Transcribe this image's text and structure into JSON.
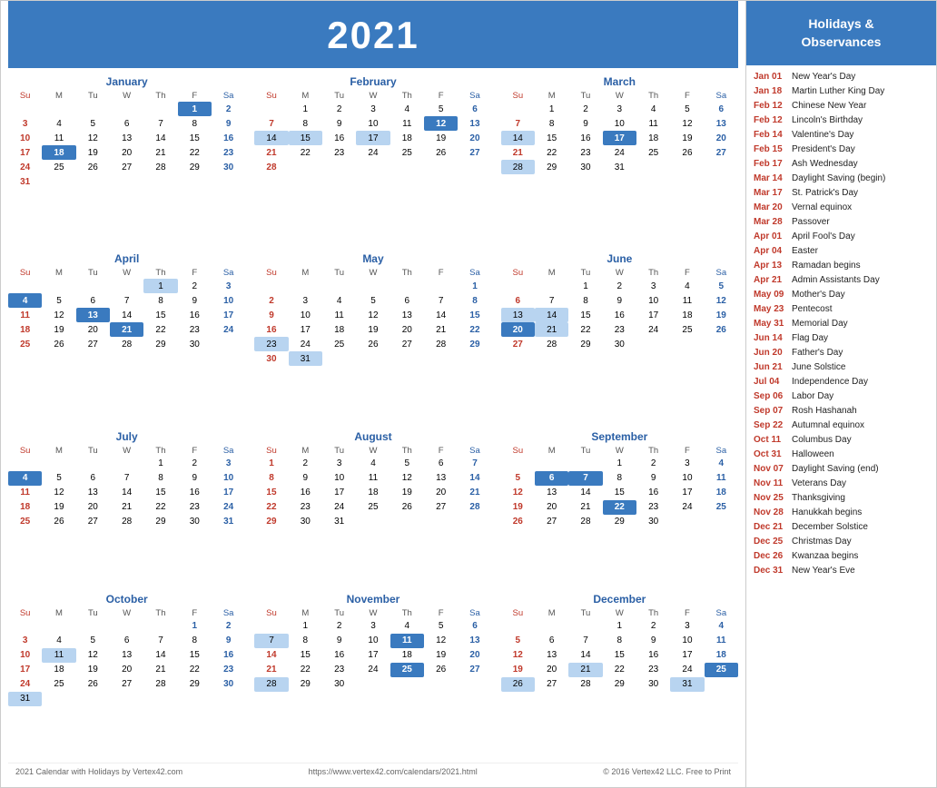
{
  "year": "2021",
  "holidays_header": "Holidays &\nObservances",
  "months": [
    {
      "name": "January",
      "days": [
        [
          null,
          null,
          null,
          null,
          null,
          1,
          2
        ],
        [
          3,
          4,
          5,
          6,
          7,
          8,
          9
        ],
        [
          10,
          11,
          12,
          13,
          14,
          15,
          16
        ],
        [
          17,
          18,
          19,
          20,
          21,
          22,
          23
        ],
        [
          24,
          25,
          26,
          27,
          28,
          29,
          30
        ],
        [
          31,
          null,
          null,
          null,
          null,
          null,
          null
        ]
      ],
      "highlights": {
        "1": "blue",
        "2": "sat",
        "18": "blue"
      }
    },
    {
      "name": "February",
      "days": [
        [
          null,
          1,
          2,
          3,
          4,
          5,
          6
        ],
        [
          7,
          8,
          9,
          10,
          11,
          12,
          13
        ],
        [
          14,
          15,
          16,
          17,
          18,
          19,
          20
        ],
        [
          21,
          22,
          23,
          24,
          25,
          26,
          27
        ],
        [
          28,
          null,
          null,
          null,
          null,
          null,
          null
        ]
      ],
      "highlights": {
        "6": "sat",
        "12": "blue",
        "13": "sat",
        "14": "light",
        "15": "light",
        "17": "light",
        "20": "sat"
      }
    },
    {
      "name": "March",
      "days": [
        [
          null,
          1,
          2,
          3,
          4,
          5,
          6
        ],
        [
          7,
          8,
          9,
          10,
          11,
          12,
          13
        ],
        [
          14,
          15,
          16,
          17,
          18,
          19,
          20
        ],
        [
          21,
          22,
          23,
          24,
          25,
          26,
          27
        ],
        [
          28,
          29,
          30,
          31,
          null,
          null,
          null
        ]
      ],
      "highlights": {
        "6": "sat",
        "13": "sat",
        "14": "light",
        "17": "blue",
        "20": "sat",
        "28": "light"
      }
    },
    {
      "name": "April",
      "days": [
        [
          null,
          null,
          null,
          null,
          1,
          2,
          3
        ],
        [
          4,
          5,
          6,
          7,
          8,
          9,
          10
        ],
        [
          11,
          12,
          13,
          14,
          15,
          16,
          17
        ],
        [
          18,
          19,
          20,
          21,
          22,
          23,
          24
        ],
        [
          25,
          26,
          27,
          28,
          29,
          30,
          null
        ]
      ],
      "highlights": {
        "1": "light",
        "3": "sat",
        "4": "blue",
        "10": "sat",
        "13": "blue",
        "17": "sat",
        "21": "blue",
        "24": "sat"
      }
    },
    {
      "name": "May",
      "days": [
        [
          null,
          null,
          null,
          null,
          null,
          null,
          1
        ],
        [
          2,
          3,
          4,
          5,
          6,
          7,
          8
        ],
        [
          9,
          10,
          11,
          12,
          13,
          14,
          15
        ],
        [
          16,
          17,
          18,
          19,
          20,
          21,
          22
        ],
        [
          23,
          24,
          25,
          26,
          27,
          28,
          29
        ],
        [
          30,
          31,
          null,
          null,
          null,
          null,
          null
        ]
      ],
      "highlights": {
        "1": "sat",
        "8": "sat",
        "15": "sat",
        "22": "sat",
        "23": "light",
        "29": "sat",
        "31": "light"
      }
    },
    {
      "name": "June",
      "days": [
        [
          null,
          null,
          1,
          2,
          3,
          4,
          5
        ],
        [
          6,
          7,
          8,
          9,
          10,
          11,
          12
        ],
        [
          13,
          14,
          15,
          16,
          17,
          18,
          19
        ],
        [
          20,
          21,
          22,
          23,
          24,
          25,
          26
        ],
        [
          27,
          28,
          29,
          30,
          null,
          null,
          null
        ]
      ],
      "highlights": {
        "5": "sat",
        "12": "sat",
        "13": "light",
        "14": "light",
        "19": "sat",
        "20": "blue",
        "21": "light",
        "26": "sat"
      }
    },
    {
      "name": "July",
      "days": [
        [
          null,
          null,
          null,
          null,
          1,
          2,
          3
        ],
        [
          4,
          5,
          6,
          7,
          8,
          9,
          10
        ],
        [
          11,
          12,
          13,
          14,
          15,
          16,
          17
        ],
        [
          18,
          19,
          20,
          21,
          22,
          23,
          24
        ],
        [
          25,
          26,
          27,
          28,
          29,
          30,
          31
        ]
      ],
      "highlights": {
        "3": "sat",
        "4": "blue",
        "10": "sat",
        "17": "sat",
        "24": "sat",
        "31": "sat"
      }
    },
    {
      "name": "August",
      "days": [
        [
          1,
          2,
          3,
          4,
          5,
          6,
          7
        ],
        [
          8,
          9,
          10,
          11,
          12,
          13,
          14
        ],
        [
          15,
          16,
          17,
          18,
          19,
          20,
          21
        ],
        [
          22,
          23,
          24,
          25,
          26,
          27,
          28
        ],
        [
          29,
          30,
          31,
          null,
          null,
          null,
          null
        ]
      ],
      "highlights": {
        "7": "sat",
        "14": "sat",
        "21": "sat",
        "28": "sat"
      }
    },
    {
      "name": "September",
      "days": [
        [
          null,
          null,
          null,
          1,
          2,
          3,
          4
        ],
        [
          5,
          6,
          7,
          8,
          9,
          10,
          11
        ],
        [
          12,
          13,
          14,
          15,
          16,
          17,
          18
        ],
        [
          19,
          20,
          21,
          22,
          23,
          24,
          25
        ],
        [
          26,
          27,
          28,
          29,
          30,
          null,
          null
        ]
      ],
      "highlights": {
        "4": "sat",
        "6": "blue",
        "7": "blue",
        "11": "sat",
        "18": "sat",
        "22": "blue",
        "25": "sat"
      }
    },
    {
      "name": "October",
      "days": [
        [
          null,
          null,
          null,
          null,
          null,
          1,
          2
        ],
        [
          3,
          4,
          5,
          6,
          7,
          8,
          9
        ],
        [
          10,
          11,
          12,
          13,
          14,
          15,
          16
        ],
        [
          17,
          18,
          19,
          20,
          21,
          22,
          23
        ],
        [
          24,
          25,
          26,
          27,
          28,
          29,
          30
        ],
        [
          31,
          null,
          null,
          null,
          null,
          null,
          null
        ]
      ],
      "highlights": {
        "1": "sat",
        "2": "sat",
        "9": "sat",
        "11": "light",
        "16": "sat",
        "23": "sat",
        "30": "sat",
        "31": "light"
      }
    },
    {
      "name": "November",
      "days": [
        [
          null,
          1,
          2,
          3,
          4,
          5,
          6
        ],
        [
          7,
          8,
          9,
          10,
          11,
          12,
          13
        ],
        [
          14,
          15,
          16,
          17,
          18,
          19,
          20
        ],
        [
          21,
          22,
          23,
          24,
          25,
          26,
          27
        ],
        [
          28,
          29,
          30,
          null,
          null,
          null,
          null
        ]
      ],
      "highlights": {
        "6": "sat",
        "7": "light",
        "11": "blue",
        "13": "sat",
        "20": "sat",
        "25": "blue",
        "27": "sat",
        "28": "light"
      }
    },
    {
      "name": "December",
      "days": [
        [
          null,
          null,
          null,
          1,
          2,
          3,
          4
        ],
        [
          5,
          6,
          7,
          8,
          9,
          10,
          11
        ],
        [
          12,
          13,
          14,
          15,
          16,
          17,
          18
        ],
        [
          19,
          20,
          21,
          22,
          23,
          24,
          25
        ],
        [
          26,
          27,
          28,
          29,
          30,
          31,
          null
        ]
      ],
      "highlights": {
        "4": "sat",
        "11": "sat",
        "18": "sat",
        "21": "light",
        "25": "blue",
        "26": "light",
        "31": "light"
      }
    }
  ],
  "holidays": [
    {
      "date": "Jan 01",
      "name": "New Year's Day"
    },
    {
      "date": "Jan 18",
      "name": "Martin Luther King Day"
    },
    {
      "date": "Feb 12",
      "name": "Chinese New Year"
    },
    {
      "date": "Feb 12",
      "name": "Lincoln's Birthday"
    },
    {
      "date": "Feb 14",
      "name": "Valentine's Day"
    },
    {
      "date": "Feb 15",
      "name": "President's Day"
    },
    {
      "date": "Feb 17",
      "name": "Ash Wednesday"
    },
    {
      "date": "Mar 14",
      "name": "Daylight Saving (begin)"
    },
    {
      "date": "Mar 17",
      "name": "St. Patrick's Day"
    },
    {
      "date": "Mar 20",
      "name": "Vernal equinox"
    },
    {
      "date": "Mar 28",
      "name": "Passover"
    },
    {
      "date": "Apr 01",
      "name": "April Fool's Day"
    },
    {
      "date": "Apr 04",
      "name": "Easter"
    },
    {
      "date": "Apr 13",
      "name": "Ramadan begins"
    },
    {
      "date": "Apr 21",
      "name": "Admin Assistants Day"
    },
    {
      "date": "May 09",
      "name": "Mother's Day"
    },
    {
      "date": "May 23",
      "name": "Pentecost"
    },
    {
      "date": "May 31",
      "name": "Memorial Day"
    },
    {
      "date": "Jun 14",
      "name": "Flag Day"
    },
    {
      "date": "Jun 20",
      "name": "Father's Day"
    },
    {
      "date": "Jun 21",
      "name": "June Solstice"
    },
    {
      "date": "Jul 04",
      "name": "Independence Day"
    },
    {
      "date": "Sep 06",
      "name": "Labor Day"
    },
    {
      "date": "Sep 07",
      "name": "Rosh Hashanah"
    },
    {
      "date": "Sep 22",
      "name": "Autumnal equinox"
    },
    {
      "date": "Oct 11",
      "name": "Columbus Day"
    },
    {
      "date": "Oct 31",
      "name": "Halloween"
    },
    {
      "date": "Nov 07",
      "name": "Daylight Saving (end)"
    },
    {
      "date": "Nov 11",
      "name": "Veterans Day"
    },
    {
      "date": "Nov 25",
      "name": "Thanksgiving"
    },
    {
      "date": "Nov 28",
      "name": "Hanukkah begins"
    },
    {
      "date": "Dec 21",
      "name": "December Solstice"
    },
    {
      "date": "Dec 25",
      "name": "Christmas Day"
    },
    {
      "date": "Dec 26",
      "name": "Kwanzaa begins"
    },
    {
      "date": "Dec 31",
      "name": "New Year's Eve"
    }
  ],
  "footer": {
    "left": "2021 Calendar with Holidays by Vertex42.com",
    "center": "https://www.vertex42.com/calendars/2021.html",
    "right": "© 2016 Vertex42 LLC. Free to Print"
  },
  "days_header": [
    "Su",
    "M",
    "Tu",
    "W",
    "Th",
    "F",
    "Sa"
  ]
}
